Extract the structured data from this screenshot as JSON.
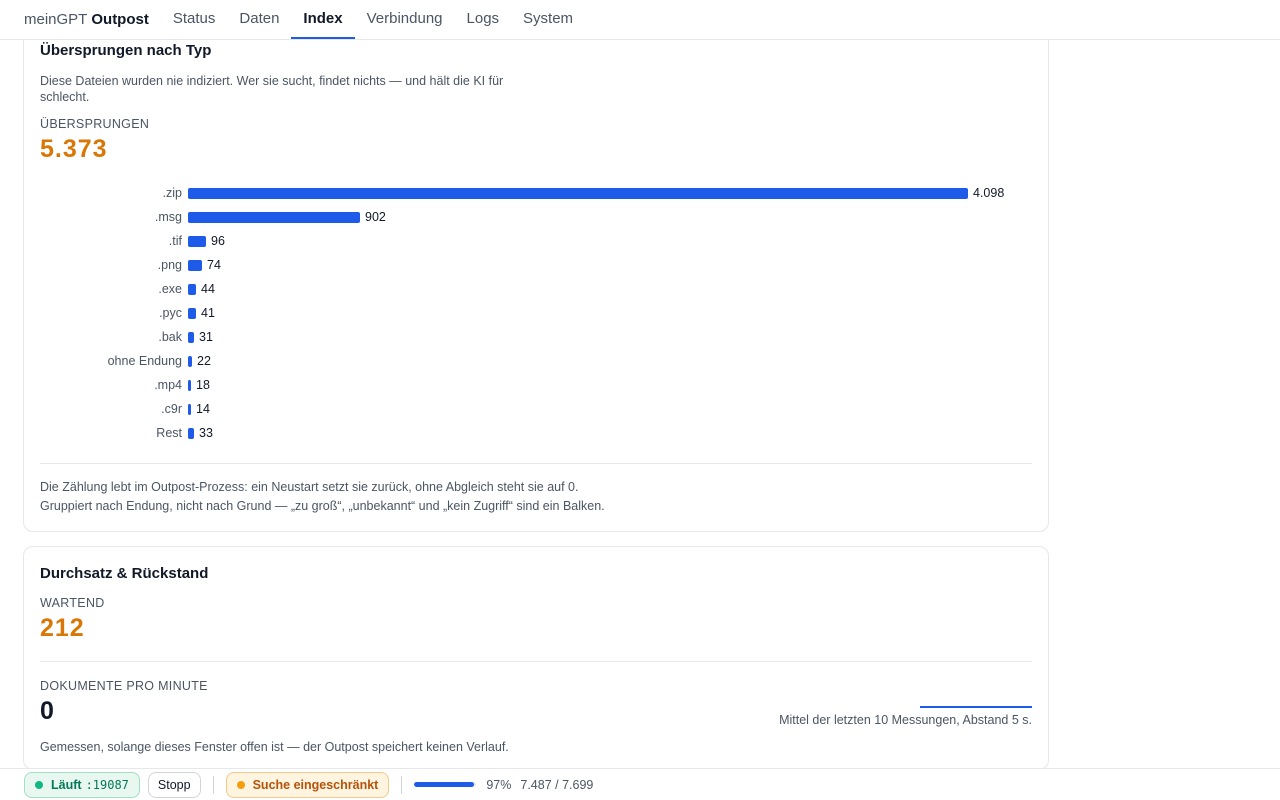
{
  "colors": {
    "accent": "#1d5be8",
    "warning": "#d97706",
    "ok": "#10b981"
  },
  "nav": {
    "brand_prefix": "meinGPT",
    "brand_name": "Outpost",
    "tabs": [
      {
        "label": "Status"
      },
      {
        "label": "Daten"
      },
      {
        "label": "Index",
        "active": true
      },
      {
        "label": "Verbindung"
      },
      {
        "label": "Logs"
      },
      {
        "label": "System"
      }
    ]
  },
  "skipped": {
    "title": "Übersprungen nach Typ",
    "description": "Diese Dateien wurden nie indiziert. Wer sie sucht, findet nichts — und hält die KI für schlecht.",
    "kpi_label": "Übersprungen",
    "kpi_value": "5.373",
    "note_line1": "Die Zählung lebt im Outpost-Prozess: ein Neustart setzt sie zurück, ohne Abgleich steht sie auf 0.",
    "note_line2": "Gruppiert nach Endung, nicht nach Grund — „zu groß“, „unbekannt“ und „kein Zugriff“ sind ein Balken."
  },
  "chart_data": {
    "type": "bar",
    "orientation": "horizontal",
    "categories": [
      ".zip",
      ".msg",
      ".tif",
      ".png",
      ".exe",
      ".pyc",
      ".bak",
      "ohne Endung",
      ".mp4",
      ".c9r",
      "Rest"
    ],
    "values": [
      4098,
      902,
      96,
      74,
      44,
      41,
      31,
      22,
      18,
      14,
      33
    ],
    "value_labels": [
      "4.098",
      "902",
      "96",
      "74",
      "44",
      "41",
      "31",
      "22",
      "18",
      "14",
      "33"
    ],
    "xlim": [
      0,
      4098
    ],
    "grid": false
  },
  "throughput": {
    "title": "Durchsatz & Rückstand",
    "waiting_label": "Wartend",
    "waiting_value": "212",
    "dpm_label": "Dokumente pro Minute",
    "dpm_value": "0",
    "avg_text": "Mittel der letzten 10 Messungen, Abstand 5 s.",
    "note": "Gemessen, solange dieses Fenster offen ist — der Outpost speichert keinen Verlauf."
  },
  "statusbar": {
    "running_label": "Läuft",
    "port": ":19087",
    "stop_label": "Stopp",
    "search_status": "Suche eingeschränkt",
    "progress_fraction": 0.97,
    "progress_pct": "97%",
    "progress_counts": "7.487 / 7.699"
  }
}
